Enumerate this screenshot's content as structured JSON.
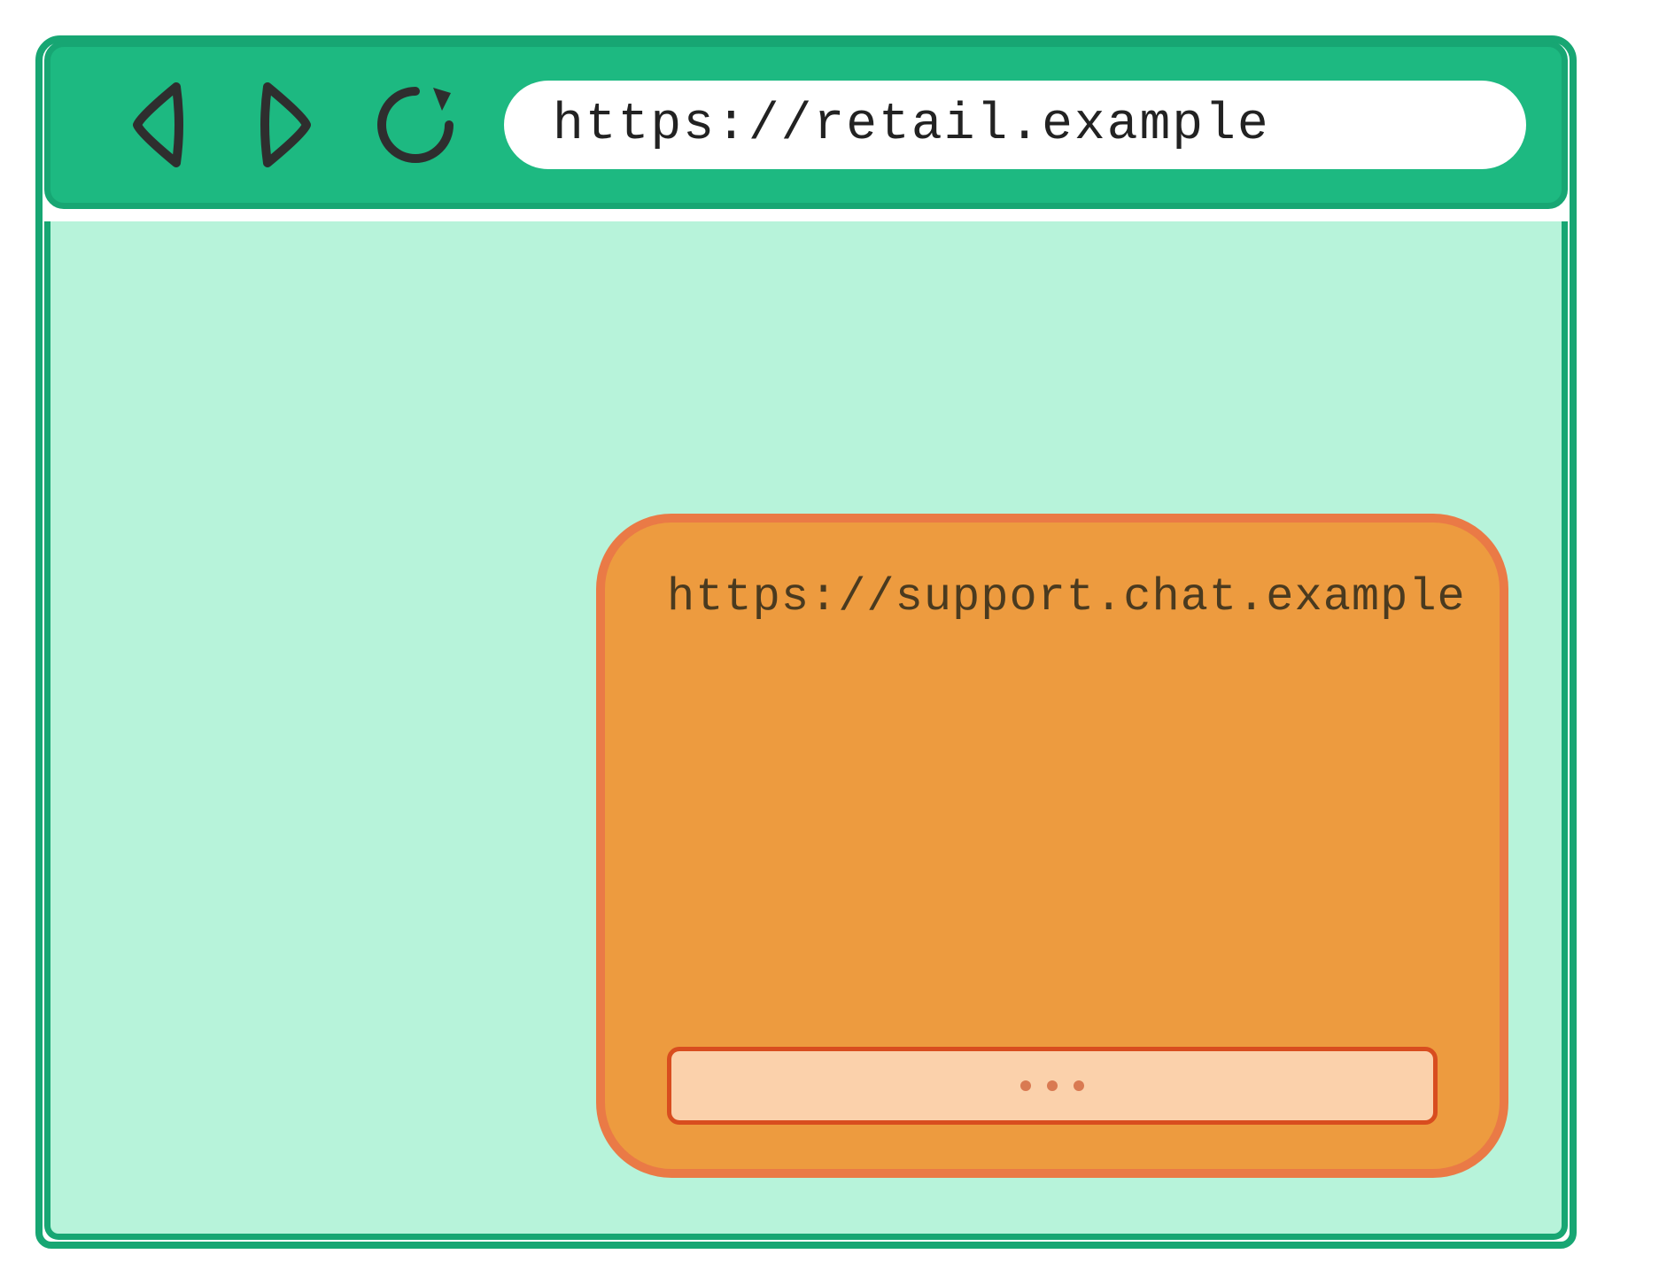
{
  "browser": {
    "address_bar": "https://retail.example",
    "nav": {
      "back_icon": "back-icon",
      "forward_icon": "forward-icon",
      "reload_icon": "reload-icon"
    }
  },
  "widget": {
    "origin_url": "https://support.chat.example",
    "input_placeholder": "..."
  },
  "colors": {
    "toolbar_bg": "#1db981",
    "toolbar_border": "#17a673",
    "viewport_bg": "#b7f3da",
    "widget_bg": "#ed9b3f",
    "widget_border": "#ea7a46",
    "input_bg": "#fbd1ab",
    "input_border": "#d84d1f"
  }
}
